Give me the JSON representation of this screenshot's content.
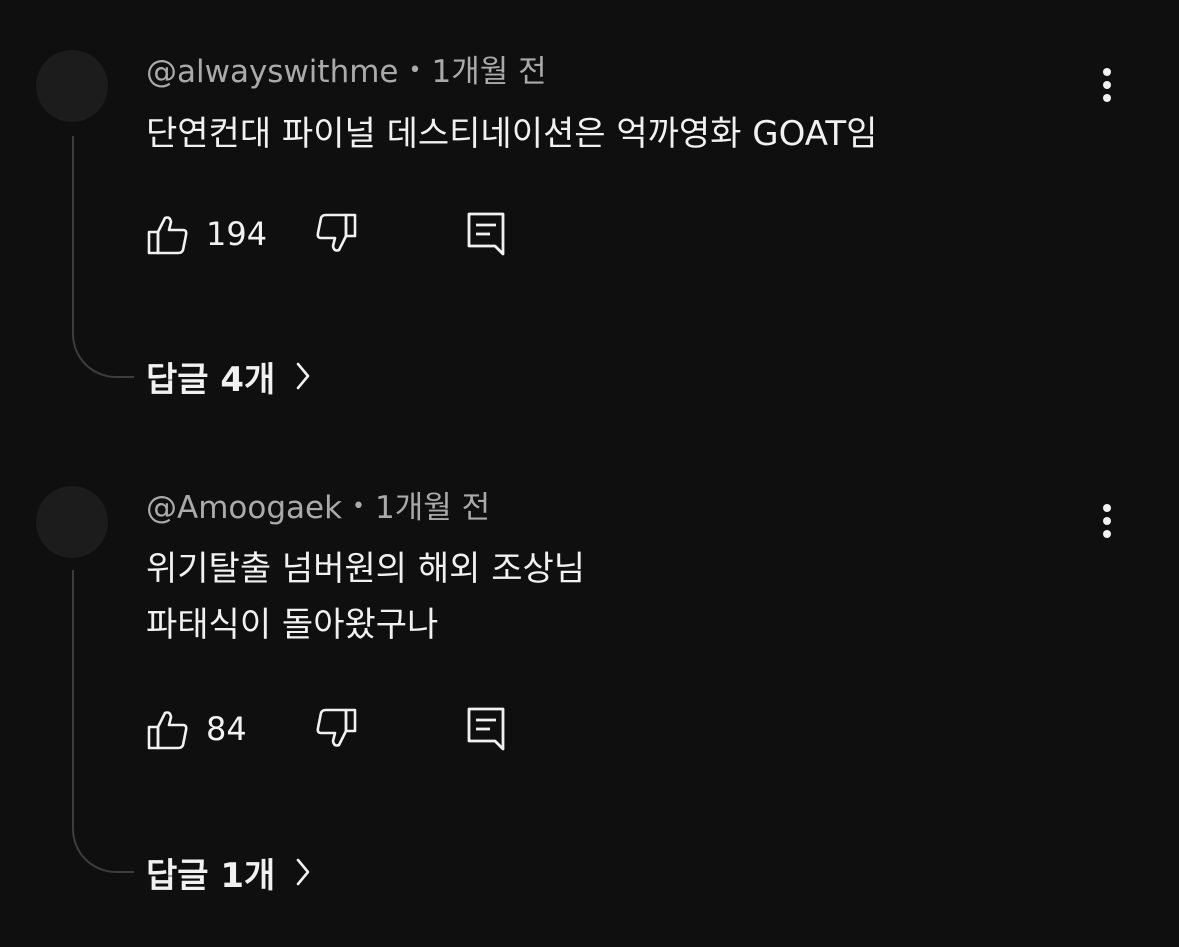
{
  "comments": [
    {
      "author": "@alwayswithme",
      "time": "1개월 전",
      "text_lines": [
        "단연컨대 파이널 데스티네이션은 억까영화 GOAT임"
      ],
      "likes": "194",
      "replies_label": "답글 4개"
    },
    {
      "author": "@Amoogaek",
      "time": "1개월 전",
      "text_lines": [
        "위기탈출 넘버원의 해외 조상님",
        "파태식이 돌아왔구나"
      ],
      "likes": "84",
      "replies_label": "답글 1개"
    }
  ],
  "icons": {
    "like": "thumbs-up-icon",
    "dislike": "thumbs-down-icon",
    "reply": "comment-reply-icon",
    "more": "more-vertical-icon",
    "chevron": "chevron-right-icon"
  },
  "colors": {
    "background": "#0f0f0f",
    "primary_text": "#f1f1f1",
    "secondary_text": "#aaaaaa",
    "thread_line": "#3d3d3d"
  }
}
